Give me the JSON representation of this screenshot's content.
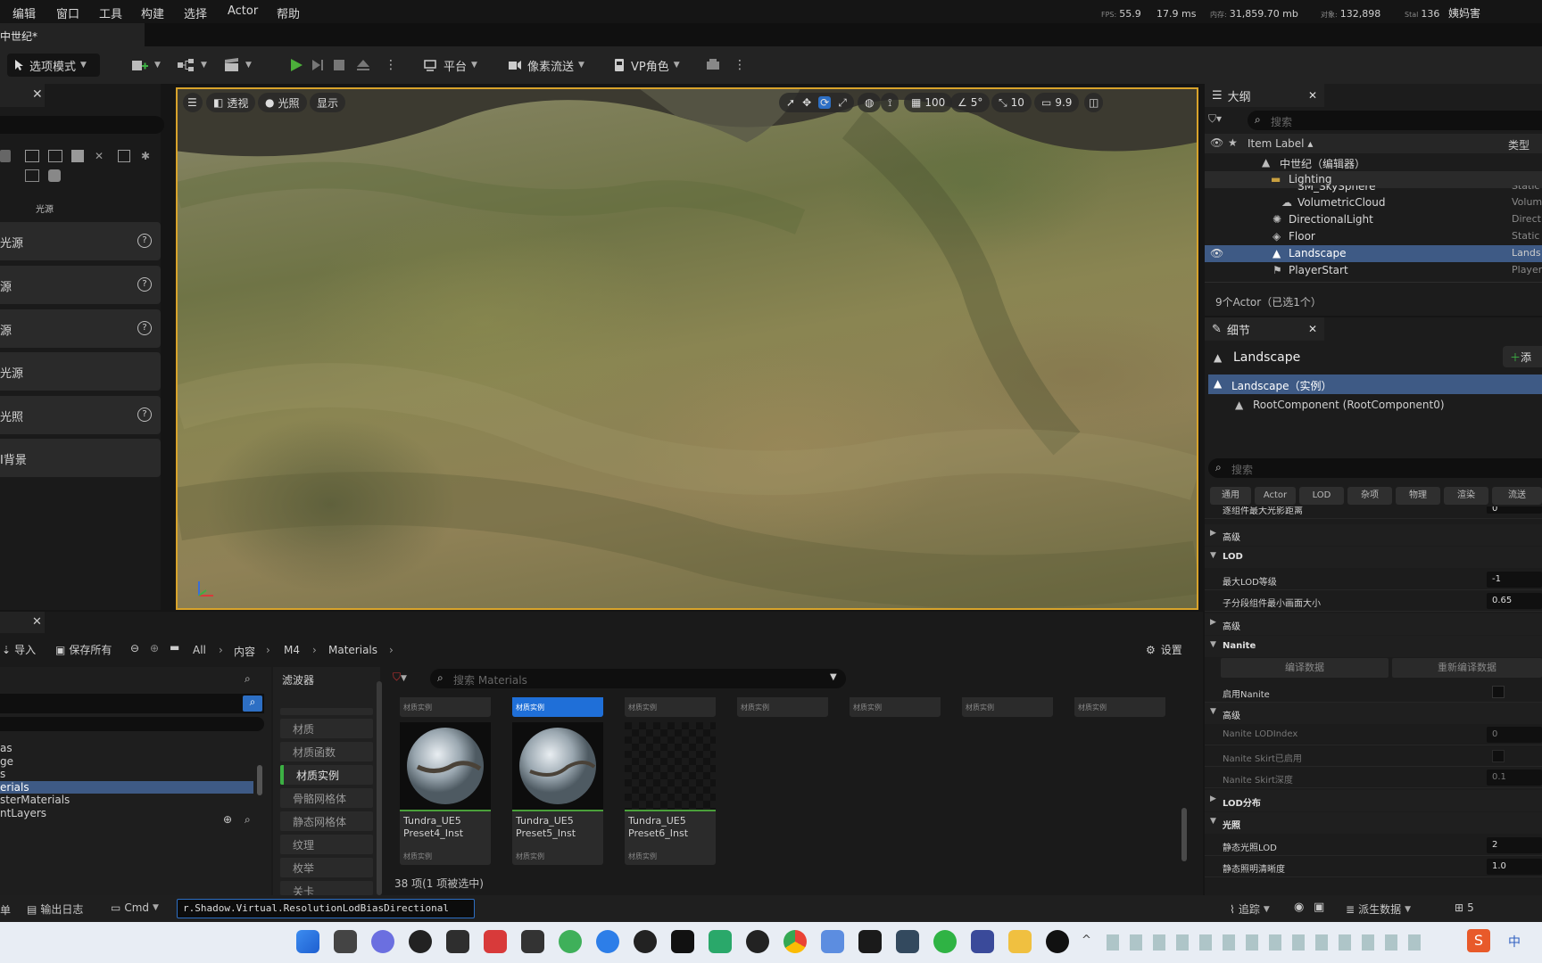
{
  "menu": [
    "编辑",
    "窗口",
    "工具",
    "构建",
    "选择",
    "Actor",
    "帮助"
  ],
  "stats": {
    "fps_label": "FPS:",
    "fps": "55.9",
    "ms": "17.9 ms",
    "mem_label": "内存:",
    "mem": "31,859.70 mb",
    "obj_label": "对象:",
    "obj": "132,898",
    "stall_label": "Stal",
    "stall": "136",
    "user": "姨妈害"
  },
  "level_tab": "中世纪*",
  "toolbar": {
    "mode": "选项模式",
    "platform": "平台",
    "pixel_streaming": "像素流送",
    "vp_role": "VP角色"
  },
  "place_panel": {
    "light_category": "光源",
    "items": [
      "光源",
      "源",
      "源",
      "光源",
      "光照",
      "I背景"
    ]
  },
  "viewport": {
    "perspective": "透视",
    "lit": "光照",
    "show": "显示",
    "grid": "100",
    "angle": "5°",
    "scale": "10",
    "cam_speed": "9.9"
  },
  "outliner": {
    "title": "大纲",
    "search_placeholder": "搜索",
    "col_label": "Item Label",
    "col_type": "类型",
    "rows": [
      {
        "label": "中世纪（编辑器）",
        "type": ""
      },
      {
        "label": "Lighting",
        "type": ""
      },
      {
        "label": "SM_SkySphere",
        "type": "Static"
      },
      {
        "label": "VolumetricCloud",
        "type": "Volum"
      },
      {
        "label": "DirectionalLight",
        "type": "Direct"
      },
      {
        "label": "Floor",
        "type": "Static"
      },
      {
        "label": "Landscape",
        "type": "Lands"
      },
      {
        "label": "PlayerStart",
        "type": "Player"
      }
    ],
    "footer": "9个Actor（已选1个）"
  },
  "details": {
    "title": "细节",
    "actor": "Landscape",
    "add_label": "添",
    "instance": "Landscape（实例）",
    "root": "RootComponent (RootComponent0)",
    "search_placeholder": "搜索",
    "cat_tabs": [
      "通用",
      "Actor",
      "LOD",
      "杂项",
      "物理",
      "渲染",
      "流送"
    ],
    "partial_row": "逐组件最大光影距离",
    "partial_val": "0",
    "sections": {
      "advanced1": "高级",
      "lod": "LOD",
      "advanced2": "高级",
      "nanite": "Nanite",
      "advanced3": "高级",
      "lod_dist": "LOD分布",
      "lighting": "光照"
    },
    "props": {
      "max_lod": "最大LOD等级",
      "max_lod_val": "-1",
      "min_screen": "子分段组件最小画面大小",
      "min_screen_val": "0.65",
      "nanite_build": "编译数据",
      "nanite_rebuild": "重新编译数据",
      "enable_nanite": "启用Nanite",
      "nanite_lod": "Nanite LODIndex",
      "nanite_lod_val": "0",
      "nanite_skirt": "Nanite Skirt已启用",
      "nanite_skirt_depth": "Nanite Skirt深度",
      "nanite_skirt_depth_val": "0.1",
      "static_lod": "静态光照LOD",
      "static_lod_val": "2",
      "static_res": "静态照明清晰度",
      "static_res_val": "1.0"
    }
  },
  "content_browser": {
    "import": "导入",
    "save_all": "保存所有",
    "path": [
      "All",
      "内容",
      "M4",
      "Materials"
    ],
    "settings": "设置",
    "folders": [
      "as",
      "ge",
      "s",
      "erials",
      "sterMaterials",
      "ntLayers"
    ],
    "filter_title": "滤波器",
    "filters": [
      "材质",
      "材质函数",
      "材质实例",
      "骨骼网格体",
      "静态网格体",
      "纹理",
      "枚举",
      "关卡"
    ],
    "search_placeholder": "搜索 Materials",
    "asset_kind": "材质实例",
    "assets": [
      {
        "name": "Tundra_UE5 Preset4_Inst",
        "kind": "材质实例"
      },
      {
        "name": "Tundra_UE5 Preset5_Inst",
        "kind": "材质实例"
      },
      {
        "name": "Tundra_UE5 Preset6_Inst",
        "kind": "材质实例"
      }
    ],
    "count": "38 项(1 项被选中)"
  },
  "statusbar": {
    "drawer": "单",
    "output_log": "输出日志",
    "cmd": "Cmd",
    "console_value": "r.Shadow.Virtual.ResolutionLodBiasDirectional",
    "trace": "追踪",
    "derived": "派生数据",
    "src": "5"
  },
  "taskbar": {
    "ime": "中"
  }
}
